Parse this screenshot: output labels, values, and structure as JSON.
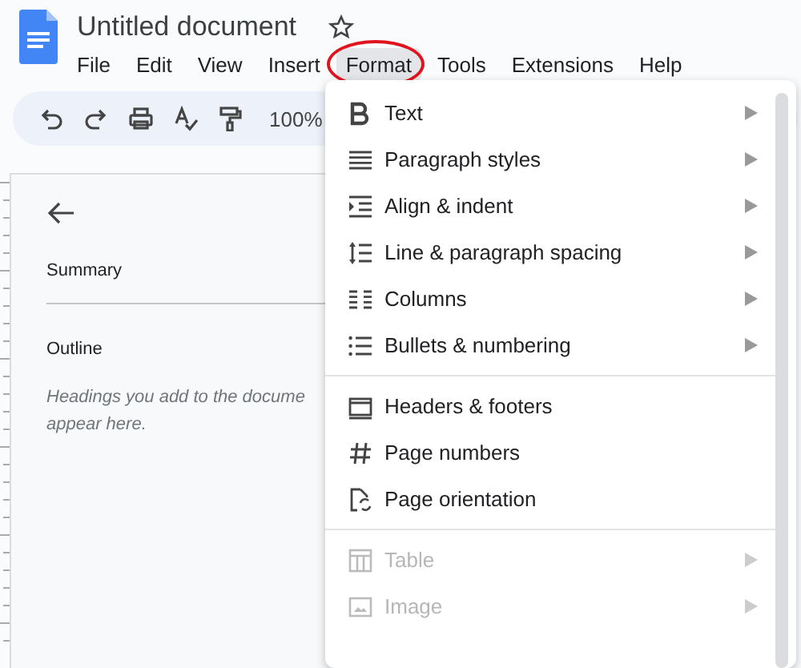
{
  "document": {
    "title": "Untitled document",
    "starred": false
  },
  "menu_bar": [
    {
      "label": "File",
      "selected": false
    },
    {
      "label": "Edit",
      "selected": false
    },
    {
      "label": "View",
      "selected": false
    },
    {
      "label": "Insert",
      "selected": false
    },
    {
      "label": "Format",
      "selected": true
    },
    {
      "label": "Tools",
      "selected": false
    },
    {
      "label": "Extensions",
      "selected": false
    },
    {
      "label": "Help",
      "selected": false
    }
  ],
  "toolbar": {
    "zoom": "100%"
  },
  "outline_panel": {
    "summary_label": "Summary",
    "outline_label": "Outline",
    "hint": "Headings you add to the docume\nappear here."
  },
  "format_menu": {
    "groups": [
      [
        {
          "label": "Text",
          "submenu": true,
          "disabled": false
        },
        {
          "label": "Paragraph styles",
          "submenu": true,
          "disabled": false
        },
        {
          "label": "Align & indent",
          "submenu": true,
          "disabled": false
        },
        {
          "label": "Line & paragraph spacing",
          "submenu": true,
          "disabled": false
        },
        {
          "label": "Columns",
          "submenu": true,
          "disabled": false
        },
        {
          "label": "Bullets & numbering",
          "submenu": true,
          "disabled": false
        }
      ],
      [
        {
          "label": "Headers & footers",
          "submenu": false,
          "disabled": false
        },
        {
          "label": "Page numbers",
          "submenu": false,
          "disabled": false
        },
        {
          "label": "Page orientation",
          "submenu": false,
          "disabled": false
        }
      ],
      [
        {
          "label": "Table",
          "submenu": true,
          "disabled": true
        },
        {
          "label": "Image",
          "submenu": true,
          "disabled": true
        }
      ]
    ]
  }
}
